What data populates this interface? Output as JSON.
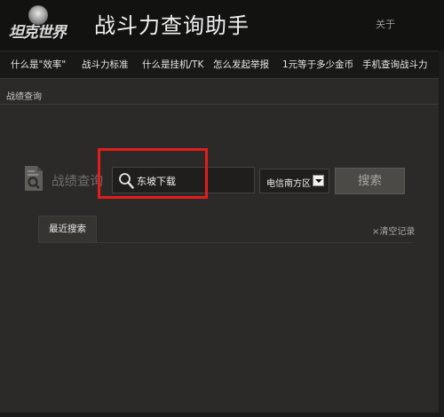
{
  "app": {
    "logo_text": "坦克世界",
    "title": "战斗力查询助手",
    "about_label": "关于"
  },
  "nav": {
    "items": [
      {
        "label": "什么是\"效率\""
      },
      {
        "label": "战斗力标准"
      },
      {
        "label": "什么是挂机/TK"
      },
      {
        "label": "怎么发起举报"
      },
      {
        "label": "1元等于多少金币"
      },
      {
        "label": "手机查询战斗力"
      }
    ]
  },
  "breadcrumb": "战绩查询",
  "search": {
    "label": "战绩查询",
    "value": "东坡下载",
    "region": "电信南方区",
    "button_label": "搜索"
  },
  "recent": {
    "tab_label": "最近搜索",
    "clear_label": "×清空记录"
  },
  "colors": {
    "background": "#2b2a28",
    "titlebar": "#121211",
    "highlight_box": "#e41c1c"
  }
}
